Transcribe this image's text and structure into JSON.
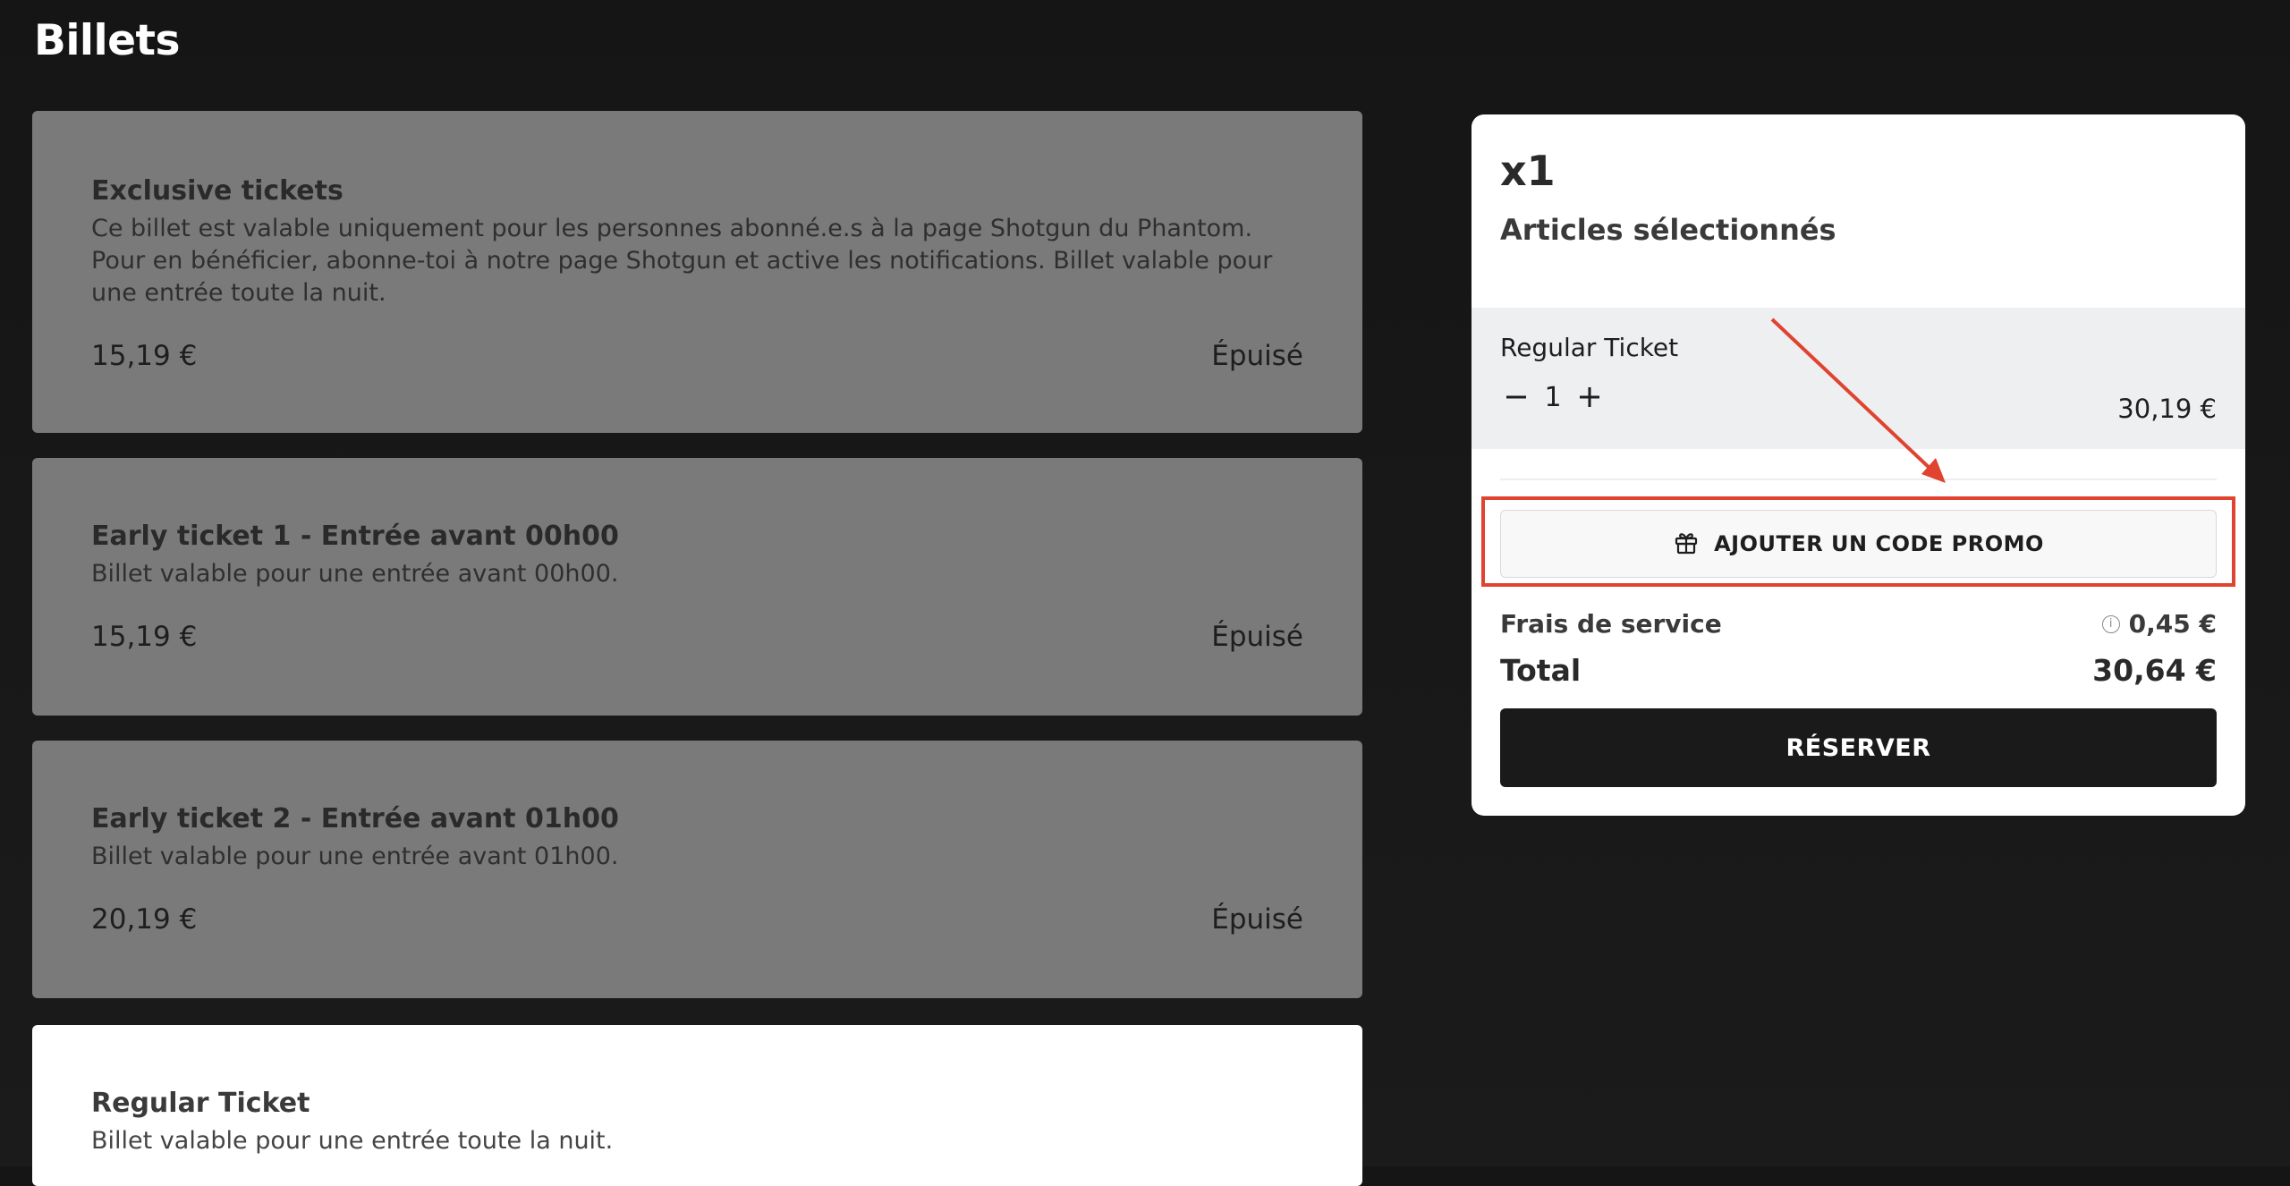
{
  "page": {
    "title": "Billets"
  },
  "tickets": [
    {
      "title": "Exclusive tickets",
      "description": "Ce billet est valable uniquement pour les personnes abonné.e.s à la page Shotgun du Phantom. Pour en bénéficier, abonne-toi à notre page Shotgun et active les notifications. Billet valable pour une entrée toute la nuit.",
      "price": "15,19 €",
      "status": "Épuisé"
    },
    {
      "title": "Early ticket 1 - Entrée avant 00h00",
      "description": "Billet valable pour une entrée avant 00h00.",
      "price": "15,19 €",
      "status": "Épuisé"
    },
    {
      "title": "Early ticket 2 - Entrée avant 01h00",
      "description": "Billet valable pour une entrée avant 01h00.",
      "price": "20,19 €",
      "status": "Épuisé"
    },
    {
      "title": "Regular Ticket",
      "description": "Billet valable pour une entrée toute la nuit."
    }
  ],
  "summary": {
    "count": "x1",
    "subtitle": "Articles sélectionnés",
    "item": {
      "name": "Regular Ticket",
      "quantity": "1",
      "price": "30,19 €",
      "minus_icon": "minus-icon",
      "plus_icon": "plus-icon"
    },
    "promo": {
      "label": "AJOUTER UN CODE PROMO",
      "icon": "gift-icon"
    },
    "fees": {
      "label": "Frais de service",
      "value": "0,45 €",
      "icon": "info-icon",
      "info_glyph": "i"
    },
    "total": {
      "label": "Total",
      "value": "30,64 €"
    },
    "reserve_label": "RÉSERVER"
  },
  "annotation": {
    "color": "#e0432f"
  }
}
